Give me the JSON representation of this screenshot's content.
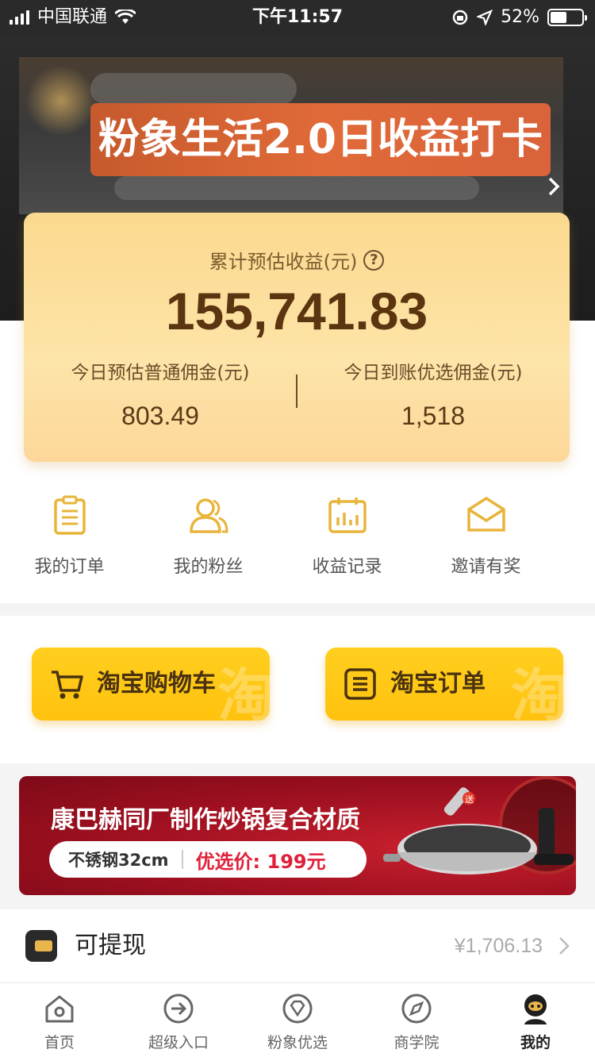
{
  "status_bar": {
    "carrier": "中国联通",
    "time": "下午11:57",
    "battery": "52%",
    "battery_level": 0.52
  },
  "banner": {
    "title": "粉象生活2.0日收益打卡"
  },
  "earnings": {
    "total_label": "累计预估收益(元)",
    "total_value": "155,741.83",
    "left_label": "今日预估普通佣金(元)",
    "left_value": "803.49",
    "right_label": "今日到账优选佣金(元)",
    "right_value": "1,518"
  },
  "quick_actions": [
    {
      "label": "我的订单",
      "icon": "clipboard-icon"
    },
    {
      "label": "我的粉丝",
      "icon": "people-icon"
    },
    {
      "label": "收益记录",
      "icon": "calendar-chart-icon"
    },
    {
      "label": "邀请有奖",
      "icon": "envelope-icon"
    }
  ],
  "taobao": {
    "cart_label": "淘宝购物车",
    "orders_label": "淘宝订单",
    "watermark": "淘"
  },
  "ad": {
    "headline": "康巴赫同厂制作炒锅复合材质",
    "spec": "不锈钢32cm",
    "price": "优选价: 199元",
    "sticker": "送"
  },
  "withdraw": {
    "label": "可提现",
    "amount": "¥1,706.13"
  },
  "tabs": [
    {
      "label": "首页",
      "icon": "home-icon"
    },
    {
      "label": "超级入口",
      "icon": "enter-arrow-icon"
    },
    {
      "label": "粉象优选",
      "icon": "diamond-icon"
    },
    {
      "label": "商学院",
      "icon": "compass-icon"
    },
    {
      "label": "我的",
      "icon": "profile-icon",
      "active": true
    }
  ],
  "colors": {
    "accent_gold": "#e9b64d",
    "card_gold": "#fde4a8",
    "button_yellow": "#ffc20e",
    "ad_red": "#9e1020"
  }
}
